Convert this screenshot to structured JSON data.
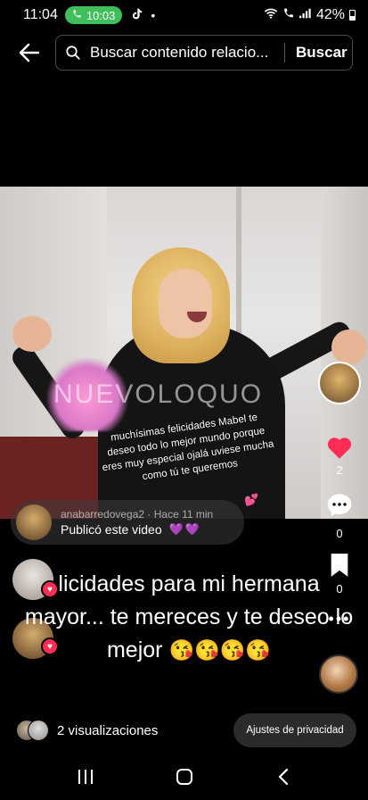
{
  "status_bar": {
    "time": "11:04",
    "call_time": "10:03",
    "battery": "42%",
    "icons": [
      "phone-icon",
      "tiktok-icon",
      "dot-icon",
      "wifi-icon",
      "wifi-call-icon",
      "signal-icon",
      "battery-icon"
    ]
  },
  "search": {
    "value": "Buscar contenido relacio...",
    "button_label": "Buscar"
  },
  "video": {
    "watermark": "NUEVOLOQUO",
    "caption_overlay": "muchísimas felicidades Mabel te deseo todo lo mejor mundo porque eres muy especial ojalá uviese mucha como tú te queremos"
  },
  "actions": {
    "like_count": "2",
    "comment_count": "0",
    "save_count": "0",
    "like_color": "#ff2d55"
  },
  "repost": {
    "username": "anabarredovega2 · Hace 11 min",
    "label": "Publicó este video",
    "hearts": "💜💜"
  },
  "comment": {
    "text": "licidades para mi hermana mayor... te mereces y te deseo lo mejor",
    "emojis": "😘😘😘😘"
  },
  "footer": {
    "views": "2 visualizaciones",
    "privacy_button": "Ajustes de privacidad"
  }
}
